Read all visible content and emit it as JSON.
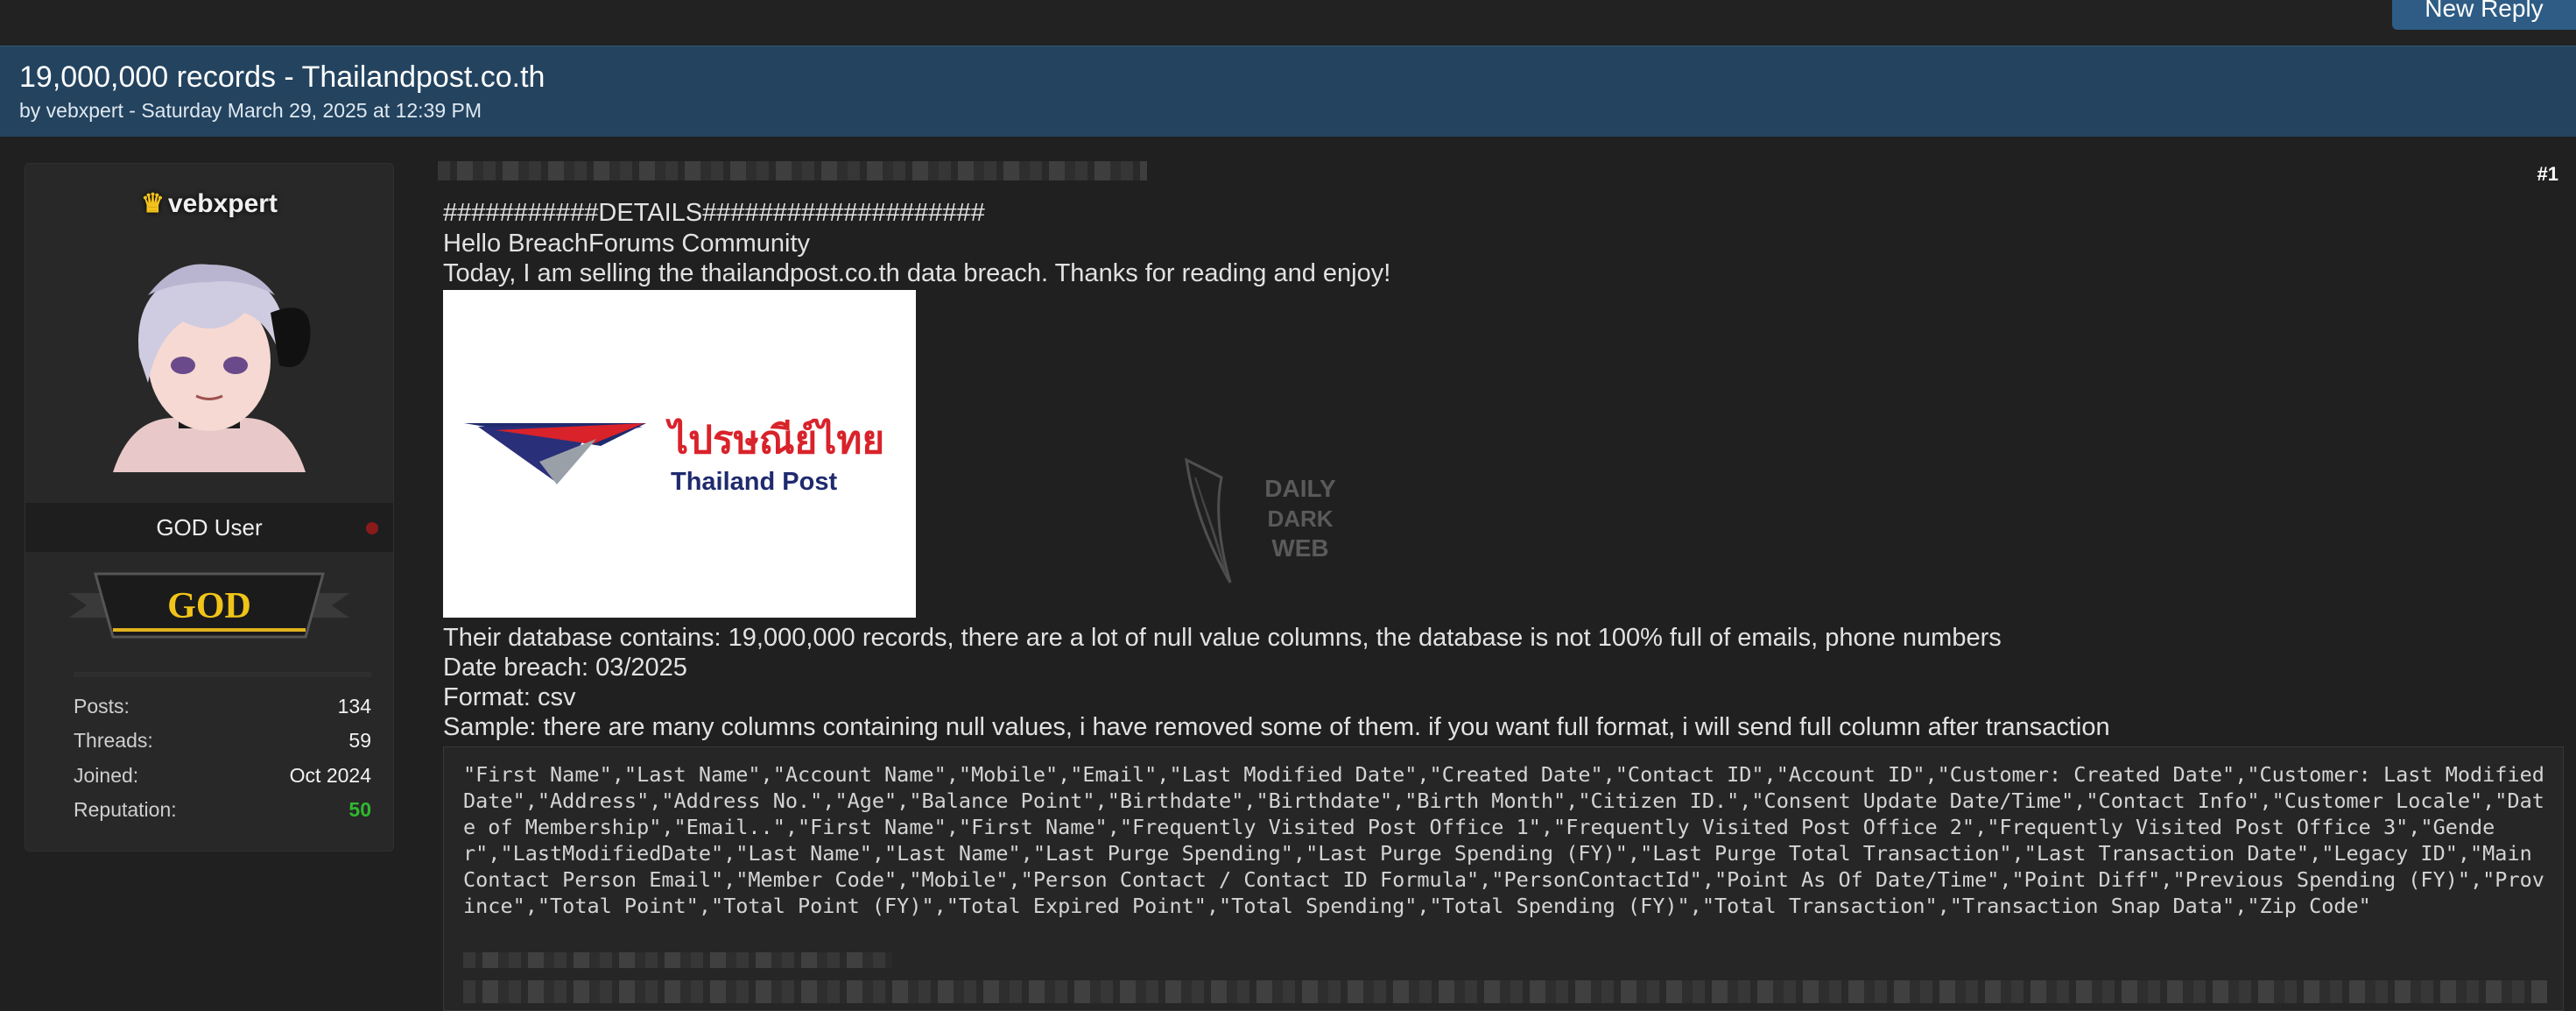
{
  "toolbar": {
    "new_reply_label": "New Reply"
  },
  "thread": {
    "title": "19,000,000 records - Thailandpost.co.th",
    "meta": "by vebxpert - Saturday March 29, 2025 at 12:39 PM"
  },
  "author": {
    "username": "vebxpert",
    "crown_icon": "crown-icon",
    "rank": "GOD User",
    "badge_text": "GOD",
    "stats": [
      {
        "label": "Posts:",
        "value": "134"
      },
      {
        "label": "Threads:",
        "value": "59"
      },
      {
        "label": "Joined:",
        "value": "Oct 2024"
      },
      {
        "label": "Reputation:",
        "value": "50"
      }
    ],
    "colors": {
      "reputation": "#2fb82f",
      "status_dot": "#8a1b1b"
    }
  },
  "post": {
    "number": "#1",
    "lines_top": [
      "###########DETAILS####################",
      "Hello BreachForums Community",
      "Today, I am selling the thailandpost.co.th data breach. Thanks for reading and enjoy!"
    ],
    "logo": {
      "thai": "ไปรษณีย์ไทย",
      "english": "Thailand Post"
    },
    "watermark": {
      "line1": "DAILY",
      "line2": "DARK",
      "line3": "WEB"
    },
    "lines_bottom": [
      "Their database contains: 19,000,000 records, there are a lot of null value columns, the database is not 100% full of emails, phone numbers",
      "Date breach: 03/2025",
      "Format: csv",
      "Sample: there are many columns containing null values, i have removed some of them. if you want full format, i will send full column after transaction"
    ],
    "code": "\"First Name\",\"Last Name\",\"Account Name\",\"Mobile\",\"Email\",\"Last Modified Date\",\"Created Date\",\"Contact ID\",\"Account ID\",\"Customer: Created Date\",\"Customer: Last Modified Date\",\"Address\",\"Address No.\",\"Age\",\"Balance Point\",\"Birthdate\",\"Birthdate\",\"Birth Month\",\"Citizen ID.\",\"Consent Update Date/Time\",\"Contact Info\",\"Customer Locale\",\"Date of Membership\",\"Email..\",\"First Name\",\"First Name\",\"Frequently Visited Post Office 1\",\"Frequently Visited Post Office 2\",\"Frequently Visited Post Office 3\",\"Gender\",\"LastModifiedDate\",\"Last Name\",\"Last Name\",\"Last Purge Spending\",\"Last Purge Spending (FY)\",\"Last Purge Total Transaction\",\"Last Transaction Date\",\"Legacy ID\",\"Main Contact Person Email\",\"Member Code\",\"Mobile\",\"Person Contact / Contact ID Formula\",\"PersonContactId\",\"Point As Of Date/Time\",\"Point Diff\",\"Previous Spending (FY)\",\"Province\",\"Total Point\",\"Total Point (FY)\",\"Total Expired Point\",\"Total Spending\",\"Total Spending (FY)\",\"Total Transaction\",\"Transaction Snap Data\",\"Zip Code\""
  }
}
